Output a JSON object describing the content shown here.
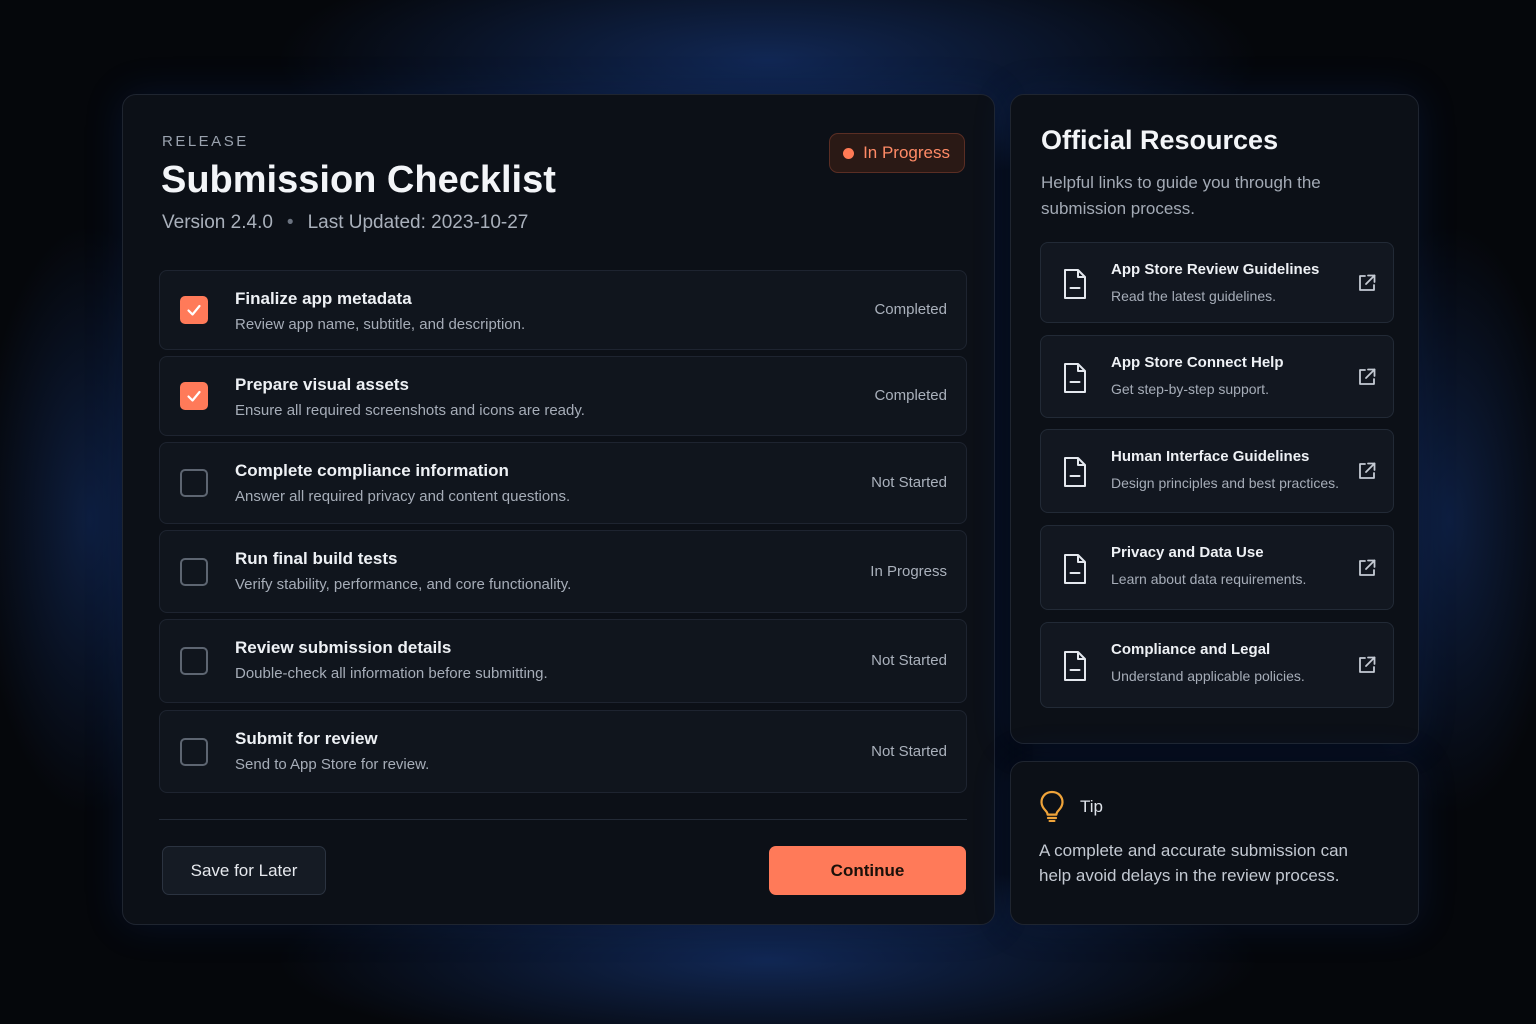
{
  "checklist": {
    "eyebrow": "RELEASE",
    "title": "Submission Checklist",
    "version": "Version 2.4.0",
    "separator": "•",
    "last_updated": "Last Updated: 2023-10-27",
    "status_badge": "In Progress",
    "tasks": [
      {
        "name": "Finalize app metadata",
        "description": "Review app name, subtitle, and description.",
        "status": "Completed",
        "checked": true
      },
      {
        "name": "Prepare visual assets",
        "description": "Ensure all required screenshots and icons are ready.",
        "status": "Completed",
        "checked": true
      },
      {
        "name": "Complete compliance information",
        "description": "Answer all required privacy and content questions.",
        "status": "Not Started",
        "checked": false
      },
      {
        "name": "Run final build tests",
        "description": "Verify stability, performance, and core functionality.",
        "status": "In Progress",
        "checked": false
      },
      {
        "name": "Review submission details",
        "description": "Double-check all information before submitting.",
        "status": "Not Started",
        "checked": false
      },
      {
        "name": "Submit for review",
        "description": "Send to App Store for review.",
        "status": "Not Started",
        "checked": false
      }
    ],
    "save_label": "Save for Later",
    "continue_label": "Continue"
  },
  "resources": {
    "title": "Official Resources",
    "subtitle": "Helpful links to guide you through the submission process.",
    "items": [
      {
        "name": "App Store Review Guidelines",
        "description": "Read the latest guidelines.",
        "icon": "document-icon",
        "action_icon": "external-link-icon"
      },
      {
        "name": "App Store Connect Help",
        "description": "Get step-by-step support.",
        "icon": "document-icon",
        "action_icon": "external-link-icon"
      },
      {
        "name": "Human Interface Guidelines",
        "description": "Design principles and best practices.",
        "icon": "document-icon",
        "action_icon": "external-link-icon"
      },
      {
        "name": "Privacy and Data Use",
        "description": "Learn about data requirements.",
        "icon": "document-icon",
        "action_icon": "external-link-icon"
      },
      {
        "name": "Compliance and Legal",
        "description": "Understand applicable policies.",
        "icon": "document-icon",
        "action_icon": "external-link-icon"
      }
    ]
  },
  "tip": {
    "icon": "lightbulb-icon",
    "label": "Tip",
    "text": "A complete and accurate submission can help avoid delays in the review process."
  },
  "colors": {
    "accent": "#ff7a59",
    "background": "#05070b",
    "panel": "#0c1017",
    "glow": "#2864dc"
  }
}
